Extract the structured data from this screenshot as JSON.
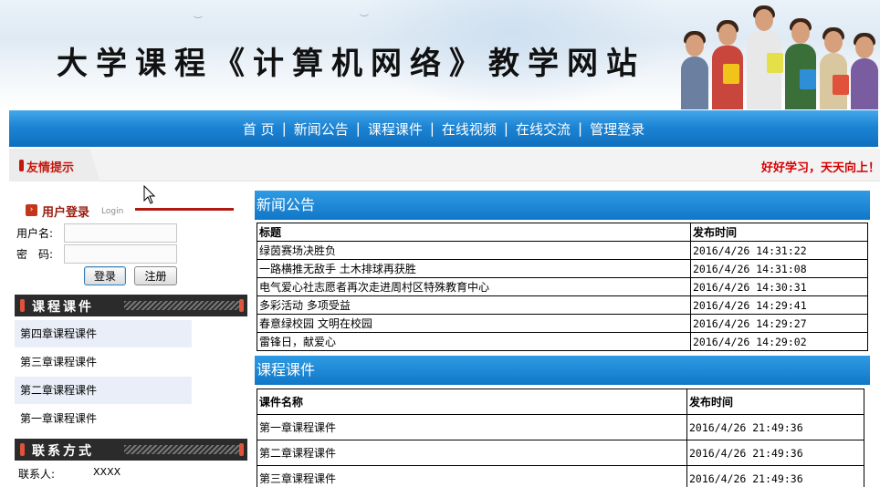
{
  "banner": {
    "title": "大学课程《计算机网络》教学网站"
  },
  "nav": {
    "items": [
      {
        "label": "首 页"
      },
      {
        "label": "新闻公告"
      },
      {
        "label": "课程课件"
      },
      {
        "label": "在线视频"
      },
      {
        "label": "在线交流"
      },
      {
        "label": "管理登录"
      }
    ],
    "separator": "|"
  },
  "tip": {
    "label": "友情提示",
    "message": "好好学习，天天向上！"
  },
  "login": {
    "title": "用户登录",
    "subtitle": "Login",
    "username_label": "用户名:",
    "password_label": "密　码:",
    "username_value": "",
    "password_value": "",
    "login_button": "登录",
    "register_button": "注册"
  },
  "courseware_sidebar": {
    "title": "课程课件",
    "items": [
      {
        "label": "第四章课程课件"
      },
      {
        "label": "第三章课程课件"
      },
      {
        "label": "第二章课程课件"
      },
      {
        "label": "第一章课程课件"
      }
    ]
  },
  "contact": {
    "title": "联系方式",
    "contact_label": "联系人:",
    "contact_value": "XXXX"
  },
  "news": {
    "title": "新闻公告",
    "headers": {
      "title": "标题",
      "time": "发布时间"
    },
    "rows": [
      {
        "title": "绿茵赛场决胜负",
        "time": "2016/4/26 14:31:22"
      },
      {
        "title": "一路横推无敌手 土木排球再获胜",
        "time": "2016/4/26 14:31:08"
      },
      {
        "title": "电气爱心社志愿者再次走进周村区特殊教育中心",
        "time": "2016/4/26 14:30:31"
      },
      {
        "title": "多彩活动 多项受益",
        "time": "2016/4/26 14:29:41"
      },
      {
        "title": "春意绿校园 文明在校园",
        "time": "2016/4/26 14:29:27"
      },
      {
        "title": "雷锋日，献爱心",
        "time": "2016/4/26 14:29:02"
      }
    ]
  },
  "courseware": {
    "title": "课程课件",
    "headers": {
      "name": "课件名称",
      "time": "发布时间"
    },
    "rows": [
      {
        "name": "第一章课程课件",
        "time": "2016/4/26 21:49:36"
      },
      {
        "name": "第二章课程课件",
        "time": "2016/4/26 21:49:36"
      },
      {
        "name": "第三章课程课件",
        "time": "2016/4/26 21:49:36"
      }
    ]
  },
  "colors": {
    "nav_blue": "#1c84d3",
    "section_blue": "#1177c8",
    "accent_red": "#c3170f",
    "sidebar_dark": "#2b2b2b"
  }
}
